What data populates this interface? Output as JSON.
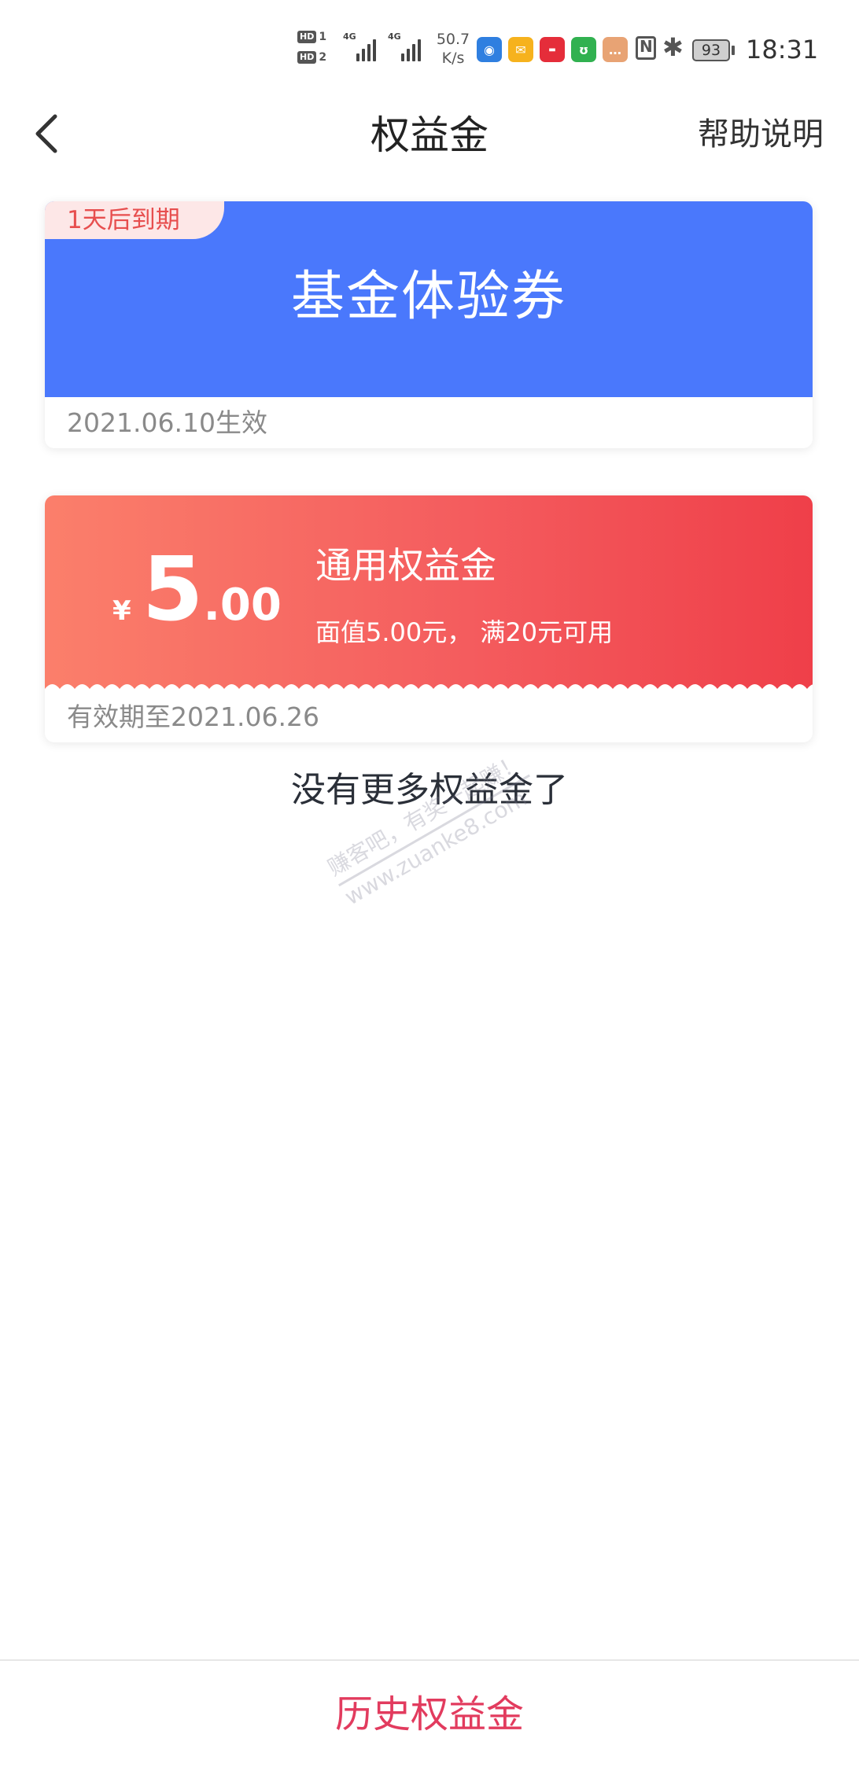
{
  "status_bar": {
    "hd1": "HD",
    "hd1_num": "1",
    "hd2": "HD",
    "hd2_num": "2",
    "network1": "4G",
    "network2": "4G",
    "speed_value": "50.7",
    "speed_unit": "K/s",
    "battery": "93",
    "time": "18:31",
    "icons": [
      "hd-icon",
      "signal-icon",
      "app-icon",
      "mail-icon",
      "news-icon",
      "wechat-mini-icon",
      "chat-icon",
      "nfc-icon",
      "bluetooth-icon",
      "battery-icon"
    ]
  },
  "nav": {
    "title": "权益金",
    "help": "帮助说明"
  },
  "cards": [
    {
      "tag": "1天后到期",
      "name": "基金体验券",
      "footer": "2021.06.10生效"
    },
    {
      "currency": "¥",
      "amount_int": "5",
      "amount_dec": ".00",
      "title": "通用权益金",
      "desc": "面值5.00元， 满20元可用",
      "footer": "有效期至2021.06.26"
    }
  ],
  "no_more": "没有更多权益金了",
  "watermark": {
    "line1": "赚客吧，有奖一起赚！",
    "line2": "www.zuanke8.com"
  },
  "bottom": {
    "history": "历史权益金"
  },
  "colors": {
    "card1_bg": "#4a78fc",
    "card2_gradient_start": "#fb7f6b",
    "card2_gradient_end": "#ef3f49",
    "expire_tag_bg": "#fde7e7",
    "expire_tag_text": "#e74e4e",
    "history_text": "#e23b5e"
  }
}
